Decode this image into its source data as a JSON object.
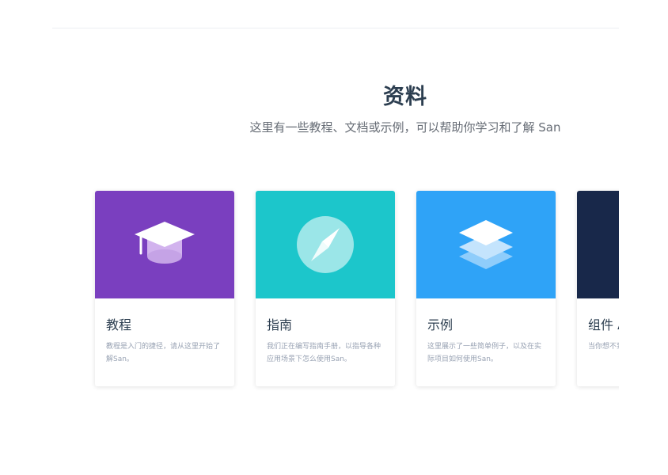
{
  "section": {
    "title": "资料",
    "subtitle": "这里有一些教程、文档或示例，可以帮助你学习和了解 San"
  },
  "cards": [
    {
      "title": "教程",
      "description": "教程是入门的捷径，请从这里开始了解San。",
      "cover_color": "#7a3fbf",
      "icon": "graduation-cap-icon"
    },
    {
      "title": "指南",
      "description": "我们正在编写指南手册，以指导各种应用场景下怎么使用San。",
      "cover_color": "#1cc6cb",
      "icon": "compass-icon"
    },
    {
      "title": "示例",
      "description": "这里展示了一些简单例子，以及在实际项目如何使用San。",
      "cover_color": "#2fa3f7",
      "icon": "layers-icon"
    },
    {
      "title": "组件 A",
      "description": "当你想不到的时候，请阅这里。",
      "cover_color": "#18284a",
      "icon": "components-icon"
    }
  ],
  "colors": {
    "title": "#2c3e50",
    "subtitle": "#666c75",
    "card_desc": "#98a2b3"
  }
}
